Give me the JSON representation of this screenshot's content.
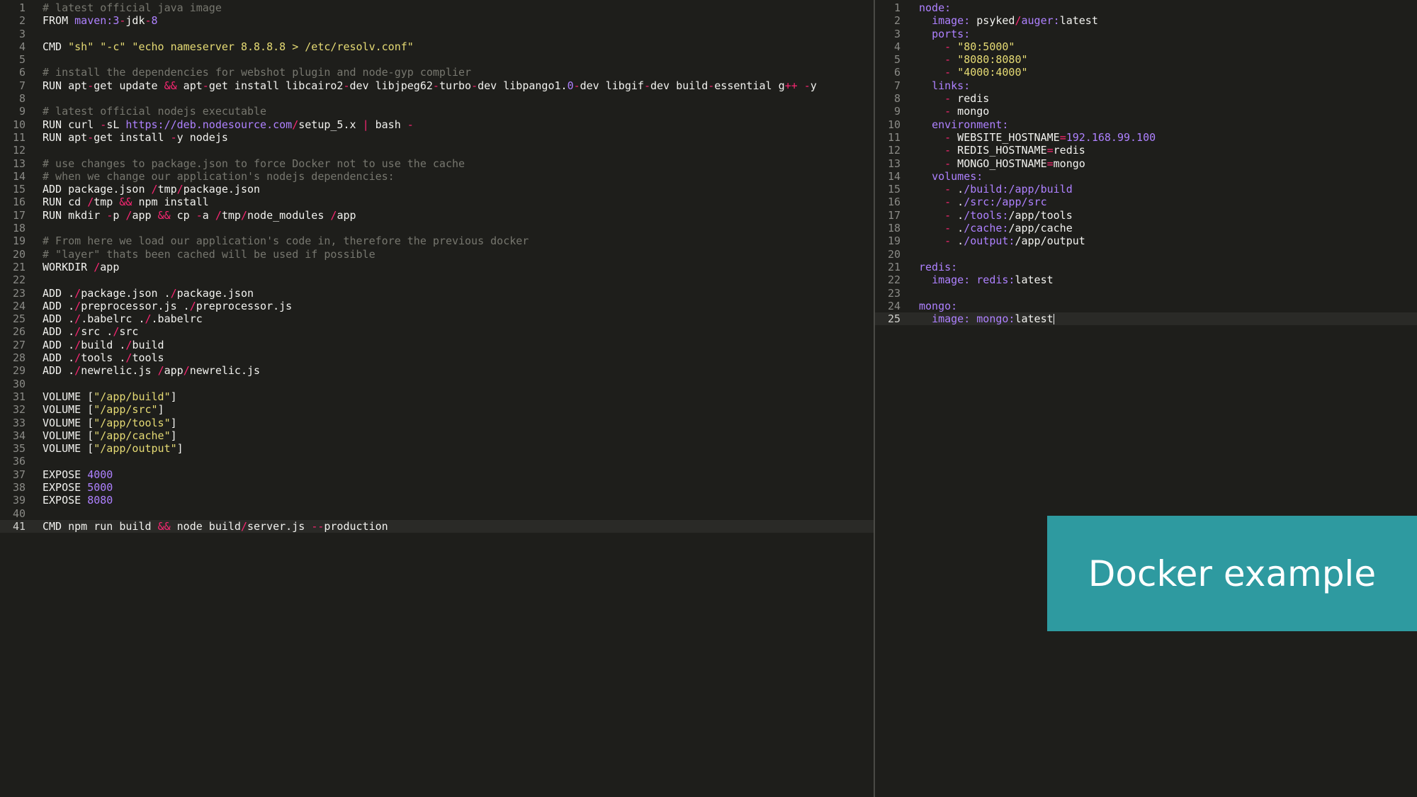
{
  "banner": {
    "text": "Docker example"
  },
  "colors": {
    "background": "#1e1e1b",
    "comment": "#77776f",
    "string": "#e6db74",
    "number": "#ae81ff",
    "operator": "#f92672",
    "key": "#ae81ff",
    "banner": "#2e9aa0"
  },
  "dockerfile": {
    "lines": [
      [
        {
          "t": "# latest official java image",
          "c": "c"
        }
      ],
      [
        {
          "t": "FROM "
        },
        {
          "t": "maven:3",
          "c": "k"
        },
        {
          "t": "-",
          "c": "o"
        },
        {
          "t": "jdk"
        },
        {
          "t": "-",
          "c": "o"
        },
        {
          "t": "8",
          "c": "n"
        }
      ],
      [],
      [
        {
          "t": "CMD "
        },
        {
          "t": "\"sh\" \"-c\" \"echo nameserver 8.8.8.8 > /etc/resolv.conf\"",
          "c": "s"
        }
      ],
      [],
      [
        {
          "t": "# install the dependencies for webshot plugin and node-gyp complier",
          "c": "c"
        }
      ],
      [
        {
          "t": "RUN apt"
        },
        {
          "t": "-",
          "c": "o"
        },
        {
          "t": "get update "
        },
        {
          "t": "&&",
          "c": "o"
        },
        {
          "t": " apt"
        },
        {
          "t": "-",
          "c": "o"
        },
        {
          "t": "get install libcairo2"
        },
        {
          "t": "-",
          "c": "o"
        },
        {
          "t": "dev libjpeg62"
        },
        {
          "t": "-",
          "c": "o"
        },
        {
          "t": "turbo"
        },
        {
          "t": "-",
          "c": "o"
        },
        {
          "t": "dev libpango1."
        },
        {
          "t": "0",
          "c": "n"
        },
        {
          "t": "-",
          "c": "o"
        },
        {
          "t": "dev libgif"
        },
        {
          "t": "-",
          "c": "o"
        },
        {
          "t": "dev build"
        },
        {
          "t": "-",
          "c": "o"
        },
        {
          "t": "essential g"
        },
        {
          "t": "++",
          "c": "o"
        },
        {
          "t": " "
        },
        {
          "t": "-",
          "c": "o"
        },
        {
          "t": "y"
        }
      ],
      [],
      [
        {
          "t": "# latest official nodejs executable",
          "c": "c"
        }
      ],
      [
        {
          "t": "RUN curl "
        },
        {
          "t": "-",
          "c": "o"
        },
        {
          "t": "sL "
        },
        {
          "t": "https:",
          "c": "k"
        },
        {
          "t": "//deb.nodesource.com",
          "c": "k"
        },
        {
          "t": "/",
          "c": "o"
        },
        {
          "t": "setup_5.x "
        },
        {
          "t": "|",
          "c": "o"
        },
        {
          "t": " bash "
        },
        {
          "t": "-",
          "c": "o"
        }
      ],
      [
        {
          "t": "RUN apt"
        },
        {
          "t": "-",
          "c": "o"
        },
        {
          "t": "get install "
        },
        {
          "t": "-",
          "c": "o"
        },
        {
          "t": "y nodejs"
        }
      ],
      [],
      [
        {
          "t": "# use changes to package.json to force Docker not to use the cache",
          "c": "c"
        }
      ],
      [
        {
          "t": "# when we change our application's nodejs dependencies:",
          "c": "c"
        }
      ],
      [
        {
          "t": "ADD package.json "
        },
        {
          "t": "/",
          "c": "o"
        },
        {
          "t": "tmp"
        },
        {
          "t": "/",
          "c": "o"
        },
        {
          "t": "package.json"
        }
      ],
      [
        {
          "t": "RUN cd "
        },
        {
          "t": "/",
          "c": "o"
        },
        {
          "t": "tmp "
        },
        {
          "t": "&&",
          "c": "o"
        },
        {
          "t": " npm install"
        }
      ],
      [
        {
          "t": "RUN mkdir "
        },
        {
          "t": "-",
          "c": "o"
        },
        {
          "t": "p "
        },
        {
          "t": "/",
          "c": "o"
        },
        {
          "t": "app "
        },
        {
          "t": "&&",
          "c": "o"
        },
        {
          "t": " cp "
        },
        {
          "t": "-",
          "c": "o"
        },
        {
          "t": "a "
        },
        {
          "t": "/",
          "c": "o"
        },
        {
          "t": "tmp"
        },
        {
          "t": "/",
          "c": "o"
        },
        {
          "t": "node_modules "
        },
        {
          "t": "/",
          "c": "o"
        },
        {
          "t": "app"
        }
      ],
      [],
      [
        {
          "t": "# From here we load our application's code in, therefore the previous docker",
          "c": "c"
        }
      ],
      [
        {
          "t": "# \"layer\" thats been cached will be used if possible",
          "c": "c"
        }
      ],
      [
        {
          "t": "WORKDIR "
        },
        {
          "t": "/",
          "c": "o"
        },
        {
          "t": "app"
        }
      ],
      [],
      [
        {
          "t": "ADD ."
        },
        {
          "t": "/",
          "c": "o"
        },
        {
          "t": "package.json ."
        },
        {
          "t": "/",
          "c": "o"
        },
        {
          "t": "package.json"
        }
      ],
      [
        {
          "t": "ADD ."
        },
        {
          "t": "/",
          "c": "o"
        },
        {
          "t": "preprocessor.js ."
        },
        {
          "t": "/",
          "c": "o"
        },
        {
          "t": "preprocessor.js"
        }
      ],
      [
        {
          "t": "ADD ."
        },
        {
          "t": "/",
          "c": "o"
        },
        {
          "t": ".babelrc ."
        },
        {
          "t": "/",
          "c": "o"
        },
        {
          "t": ".babelrc"
        }
      ],
      [
        {
          "t": "ADD ."
        },
        {
          "t": "/",
          "c": "o"
        },
        {
          "t": "src ."
        },
        {
          "t": "/",
          "c": "o"
        },
        {
          "t": "src"
        }
      ],
      [
        {
          "t": "ADD ."
        },
        {
          "t": "/",
          "c": "o"
        },
        {
          "t": "build ."
        },
        {
          "t": "/",
          "c": "o"
        },
        {
          "t": "build"
        }
      ],
      [
        {
          "t": "ADD ."
        },
        {
          "t": "/",
          "c": "o"
        },
        {
          "t": "tools ."
        },
        {
          "t": "/",
          "c": "o"
        },
        {
          "t": "tools"
        }
      ],
      [
        {
          "t": "ADD ."
        },
        {
          "t": "/",
          "c": "o"
        },
        {
          "t": "newrelic.js "
        },
        {
          "t": "/",
          "c": "o"
        },
        {
          "t": "app"
        },
        {
          "t": "/",
          "c": "o"
        },
        {
          "t": "newrelic.js"
        }
      ],
      [],
      [
        {
          "t": "VOLUME ["
        },
        {
          "t": "\"/app/build\"",
          "c": "s"
        },
        {
          "t": "]"
        }
      ],
      [
        {
          "t": "VOLUME ["
        },
        {
          "t": "\"/app/src\"",
          "c": "s"
        },
        {
          "t": "]"
        }
      ],
      [
        {
          "t": "VOLUME ["
        },
        {
          "t": "\"/app/tools\"",
          "c": "s"
        },
        {
          "t": "]"
        }
      ],
      [
        {
          "t": "VOLUME ["
        },
        {
          "t": "\"/app/cache\"",
          "c": "s"
        },
        {
          "t": "]"
        }
      ],
      [
        {
          "t": "VOLUME ["
        },
        {
          "t": "\"/app/output\"",
          "c": "s"
        },
        {
          "t": "]"
        }
      ],
      [],
      [
        {
          "t": "EXPOSE "
        },
        {
          "t": "4000",
          "c": "n"
        }
      ],
      [
        {
          "t": "EXPOSE "
        },
        {
          "t": "5000",
          "c": "n"
        }
      ],
      [
        {
          "t": "EXPOSE "
        },
        {
          "t": "8080",
          "c": "n"
        }
      ],
      [],
      [
        {
          "t": "CMD npm run build "
        },
        {
          "t": "&&",
          "c": "o"
        },
        {
          "t": " node build"
        },
        {
          "t": "/",
          "c": "o"
        },
        {
          "t": "server.js "
        },
        {
          "t": "--",
          "c": "o"
        },
        {
          "t": "production"
        }
      ]
    ],
    "active_line": 41
  },
  "compose": {
    "lines": [
      [
        {
          "t": "node:",
          "c": "k"
        }
      ],
      [
        {
          "t": "  "
        },
        {
          "t": "image:",
          "c": "k"
        },
        {
          "t": " psyked"
        },
        {
          "t": "/",
          "c": "o"
        },
        {
          "t": "auger:",
          "c": "k"
        },
        {
          "t": "latest"
        }
      ],
      [
        {
          "t": "  "
        },
        {
          "t": "ports:",
          "c": "k"
        }
      ],
      [
        {
          "t": "    "
        },
        {
          "t": "-",
          "c": "o"
        },
        {
          "t": " "
        },
        {
          "t": "\"80:5000\"",
          "c": "s"
        }
      ],
      [
        {
          "t": "    "
        },
        {
          "t": "-",
          "c": "o"
        },
        {
          "t": " "
        },
        {
          "t": "\"8080:8080\"",
          "c": "s"
        }
      ],
      [
        {
          "t": "    "
        },
        {
          "t": "-",
          "c": "o"
        },
        {
          "t": " "
        },
        {
          "t": "\"4000:4000\"",
          "c": "s"
        }
      ],
      [
        {
          "t": "  "
        },
        {
          "t": "links:",
          "c": "k"
        }
      ],
      [
        {
          "t": "    "
        },
        {
          "t": "-",
          "c": "o"
        },
        {
          "t": " redis"
        }
      ],
      [
        {
          "t": "    "
        },
        {
          "t": "-",
          "c": "o"
        },
        {
          "t": " mongo"
        }
      ],
      [
        {
          "t": "  "
        },
        {
          "t": "environment:",
          "c": "k"
        }
      ],
      [
        {
          "t": "    "
        },
        {
          "t": "-",
          "c": "o"
        },
        {
          "t": " WEBSITE_HOSTNAME"
        },
        {
          "t": "=",
          "c": "o"
        },
        {
          "t": "192.168.99.100",
          "c": "n"
        }
      ],
      [
        {
          "t": "    "
        },
        {
          "t": "-",
          "c": "o"
        },
        {
          "t": " REDIS_HOSTNAME"
        },
        {
          "t": "=",
          "c": "o"
        },
        {
          "t": "redis"
        }
      ],
      [
        {
          "t": "    "
        },
        {
          "t": "-",
          "c": "o"
        },
        {
          "t": " MONGO_HOSTNAME"
        },
        {
          "t": "=",
          "c": "o"
        },
        {
          "t": "mongo"
        }
      ],
      [
        {
          "t": "  "
        },
        {
          "t": "volumes:",
          "c": "k"
        }
      ],
      [
        {
          "t": "    "
        },
        {
          "t": "-",
          "c": "o"
        },
        {
          "t": " ."
        },
        {
          "t": "/build:",
          "c": "k"
        },
        {
          "t": "/app/build",
          "c": "k"
        }
      ],
      [
        {
          "t": "    "
        },
        {
          "t": "-",
          "c": "o"
        },
        {
          "t": " ."
        },
        {
          "t": "/src:",
          "c": "k"
        },
        {
          "t": "/app/src",
          "c": "k"
        }
      ],
      [
        {
          "t": "    "
        },
        {
          "t": "-",
          "c": "o"
        },
        {
          "t": " ."
        },
        {
          "t": "/tools:",
          "c": "k"
        },
        {
          "t": "/app/tools"
        }
      ],
      [
        {
          "t": "    "
        },
        {
          "t": "-",
          "c": "o"
        },
        {
          "t": " ."
        },
        {
          "t": "/cache:",
          "c": "k"
        },
        {
          "t": "/app/cache"
        }
      ],
      [
        {
          "t": "    "
        },
        {
          "t": "-",
          "c": "o"
        },
        {
          "t": " ."
        },
        {
          "t": "/output:",
          "c": "k"
        },
        {
          "t": "/app/output"
        }
      ],
      [],
      [
        {
          "t": "redis:",
          "c": "k"
        }
      ],
      [
        {
          "t": "  "
        },
        {
          "t": "image:",
          "c": "k"
        },
        {
          "t": " "
        },
        {
          "t": "redis:",
          "c": "k"
        },
        {
          "t": "latest"
        }
      ],
      [],
      [
        {
          "t": "mongo:",
          "c": "k"
        }
      ],
      [
        {
          "t": "  "
        },
        {
          "t": "image:",
          "c": "k"
        },
        {
          "t": " "
        },
        {
          "t": "mongo:",
          "c": "k"
        },
        {
          "t": "latest"
        }
      ]
    ],
    "active_line": 25
  }
}
